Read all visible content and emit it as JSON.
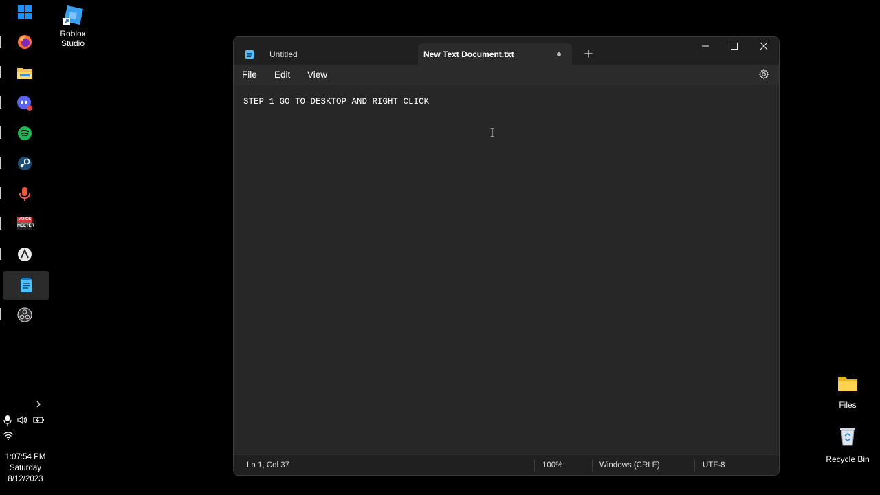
{
  "desktop": {
    "roblox_label_line1": "Roblox",
    "roblox_label_line2": "Studio",
    "files_label": "Files",
    "recycle_label": "Recycle Bin"
  },
  "taskbar": {
    "apps": [
      "windows-start",
      "firefox",
      "file-explorer",
      "discord",
      "spotify",
      "steam",
      "microphone-app",
      "voicemeeter",
      "app-a",
      "notepad",
      "obs"
    ],
    "voicemeeter_line1": "VOICE",
    "voicemeeter_line2": "MEETER",
    "time": "1:07:54 PM",
    "day": "Saturday",
    "date": "8/12/2023"
  },
  "notepad": {
    "tabs": [
      {
        "label": "Untitled",
        "active": false
      },
      {
        "label": "New Text Document.txt",
        "active": true,
        "unsaved": true
      }
    ],
    "menu": {
      "file": "File",
      "edit": "Edit",
      "view": "View"
    },
    "content": "STEP 1 GO TO DESKTOP AND RIGHT CLICK",
    "status": {
      "position": "Ln 1, Col 37",
      "zoom": "100%",
      "line_ending": "Windows (CRLF)",
      "encoding": "UTF-8"
    }
  },
  "colors": {
    "accent": "#4cc2ff",
    "window_bg": "#272727",
    "titlebar_bg": "#202020"
  }
}
